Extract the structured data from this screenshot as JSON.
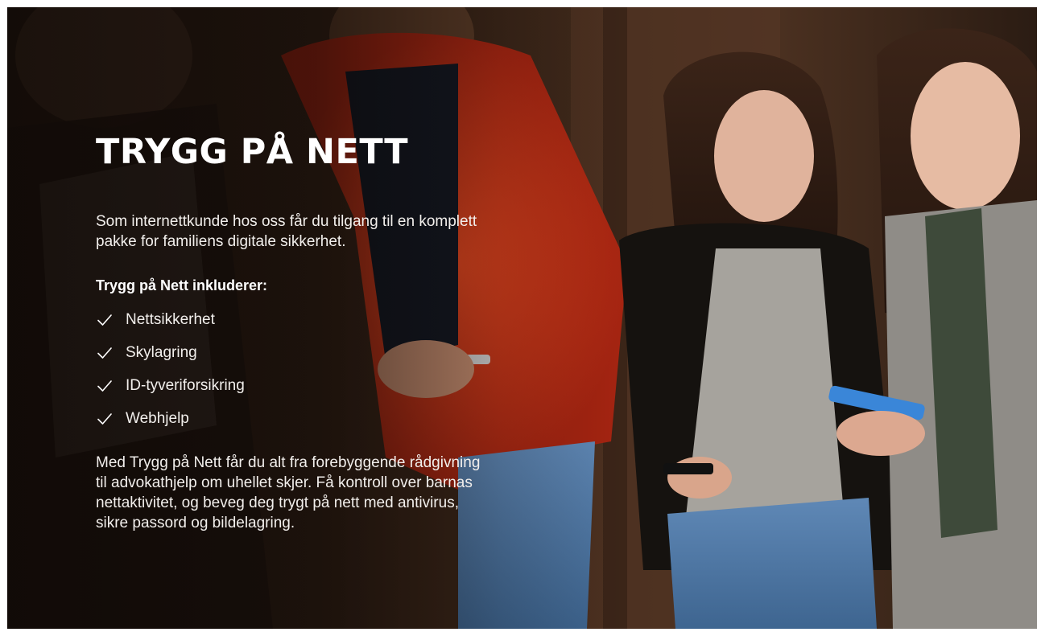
{
  "hero": {
    "title": "TRYGG PÅ NETT",
    "intro": "Som internettkunde hos oss får du tilgang til en komplett pakke for familiens digitale sikkerhet.",
    "includes_heading": "Trygg på Nett inkluderer:",
    "features": [
      {
        "label": "Nettsikkerhet",
        "icon": "check-icon"
      },
      {
        "label": "Skylagring",
        "icon": "check-icon"
      },
      {
        "label": "ID-tyveriforsikring",
        "icon": "check-icon"
      },
      {
        "label": "Webhjelp",
        "icon": "check-icon"
      }
    ],
    "outro": "Med Trygg på Nett får du alt fra forebyggende rådgivning til advokathjelp om uhellet skjer. Få kontroll over barnas nettaktivitet, og beveg deg trygt på nett med antivirus, sikre passord og bildelagring."
  },
  "colors": {
    "text": "#ffffff",
    "background_dark": "#1d130d",
    "jacket_red": "#c9301a"
  }
}
